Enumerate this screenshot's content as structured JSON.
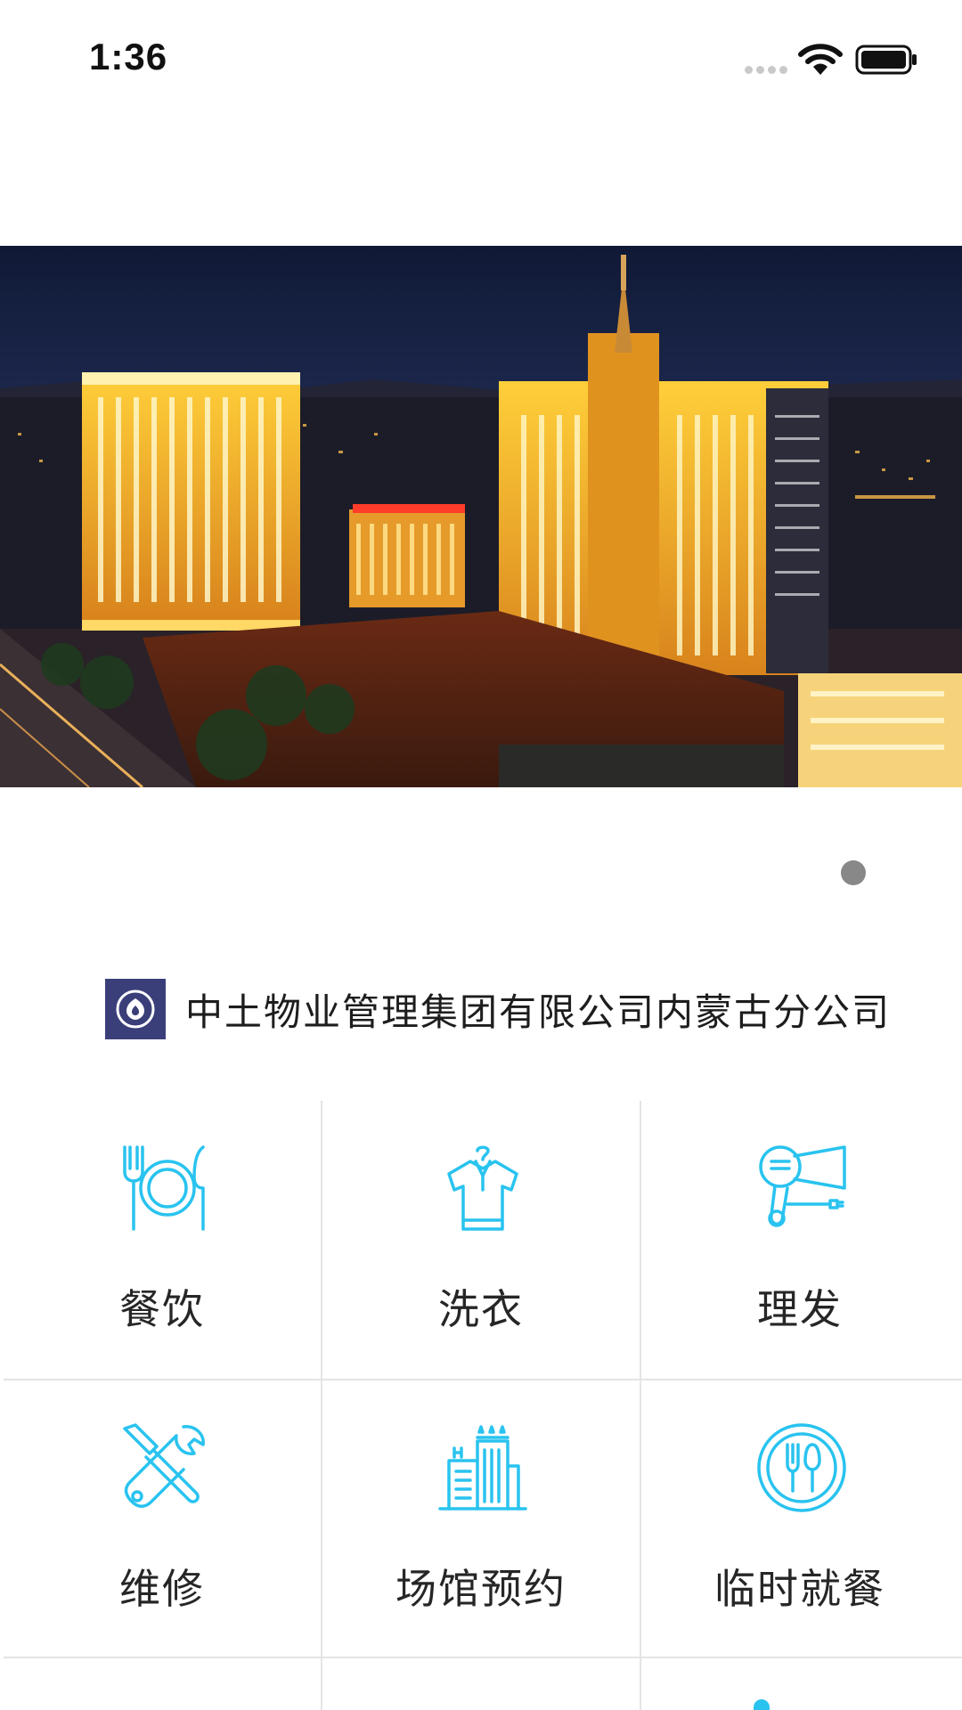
{
  "status_bar": {
    "time": "1:36"
  },
  "banner": {
    "active_page": 1,
    "page_count": 1
  },
  "company": {
    "name": "中土物业管理集团有限公司内蒙古分公司"
  },
  "services": [
    {
      "label": "餐饮",
      "icon": "dining-plate-icon"
    },
    {
      "label": "洗衣",
      "icon": "laundry-shirt-icon"
    },
    {
      "label": "理发",
      "icon": "hair-dryer-icon"
    },
    {
      "label": "维修",
      "icon": "repair-tools-icon"
    },
    {
      "label": "场馆预约",
      "icon": "venue-building-icon"
    },
    {
      "label": "临时就餐",
      "icon": "temporary-meal-icon"
    }
  ],
  "colors": {
    "icon_blue": "#29c3ef",
    "logo_bg": "#3a3f7a",
    "divider": "#e4e4e4",
    "pager_dot": "#888888"
  }
}
